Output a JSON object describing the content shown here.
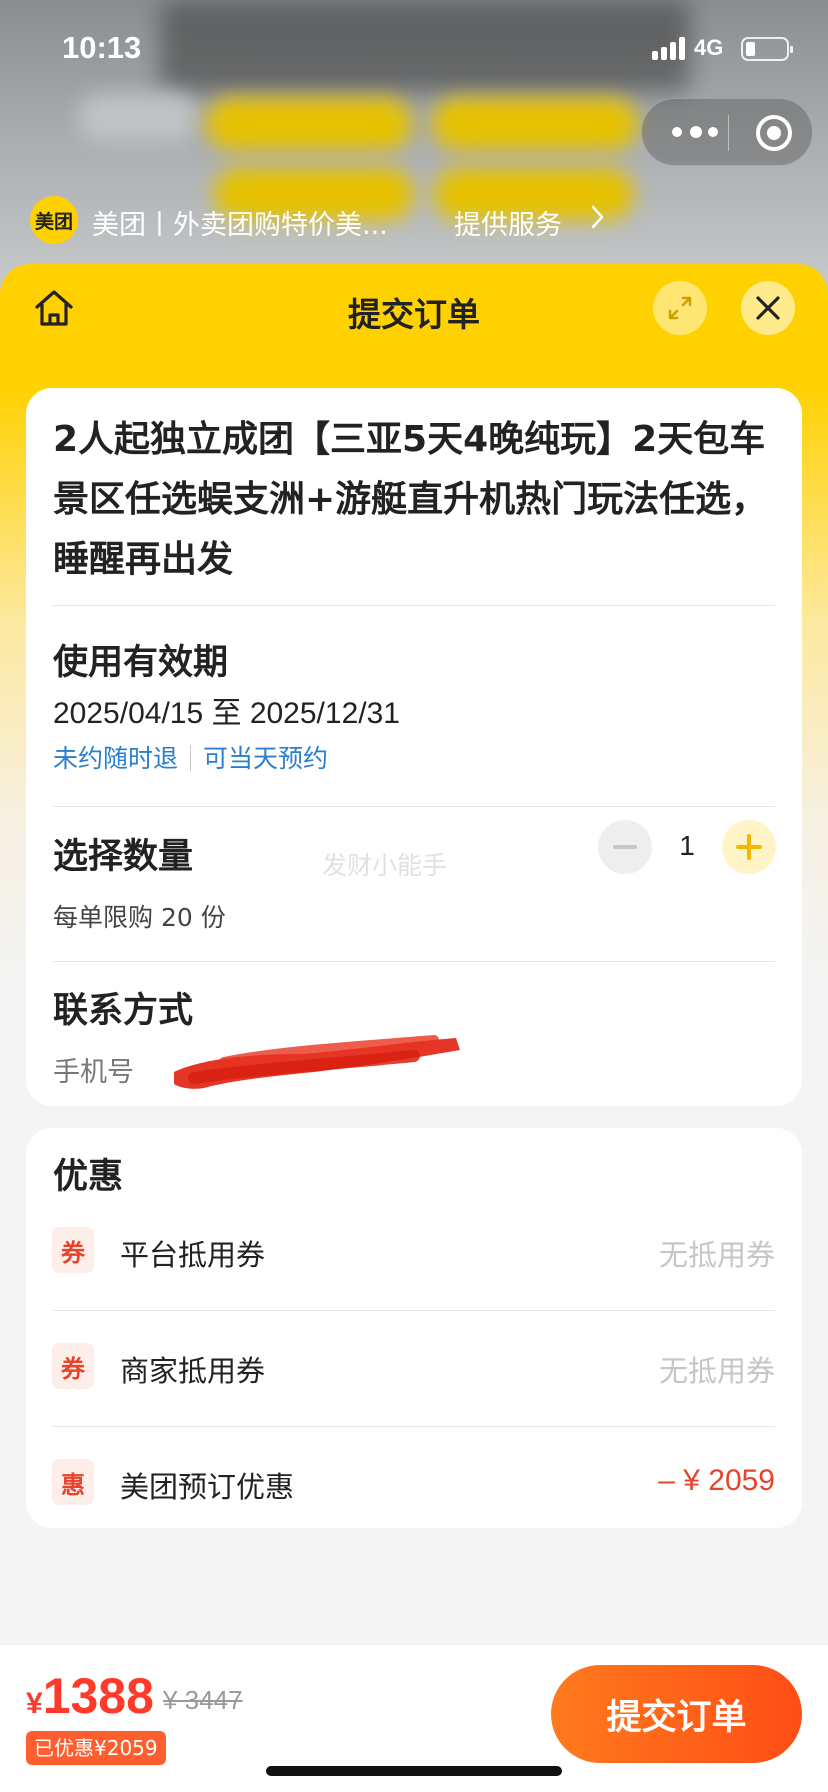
{
  "status_bar": {
    "time": "10:13",
    "network": "4G"
  },
  "mini_program": {
    "logo_text": "美团",
    "name": "美团丨外卖团购特价美...",
    "service_label": "提供服务",
    "service_icon": "chevron-right-icon"
  },
  "header": {
    "title": "提交订单",
    "home_icon": "home-icon",
    "expand_icon": "expand-icon",
    "close_icon": "close-icon"
  },
  "product": {
    "title": "2人起独立成团【三亚5天4晚纯玩】2天包车景区任选蜈支洲+游艇直升机热门玩法任选，睡醒再出发"
  },
  "validity": {
    "label": "使用有效期",
    "range": "2025/04/15 至 2025/12/31",
    "tags": [
      "未约随时退",
      "可当天预约"
    ]
  },
  "quantity": {
    "label": "选择数量",
    "value": "1",
    "limit_text": "每单限购 20 份"
  },
  "watermark": "发财小能手",
  "contact": {
    "label": "联系方式",
    "phone_label": "手机号"
  },
  "discounts": {
    "title": "优惠",
    "items": [
      {
        "badge": "券",
        "name": "平台抵用券",
        "value": "无抵用券"
      },
      {
        "badge": "券",
        "name": "商家抵用券",
        "value": "无抵用券"
      },
      {
        "badge": "惠",
        "name": "美团预订优惠",
        "value": "– ¥ 2059"
      }
    ]
  },
  "bottom": {
    "currency": "¥",
    "price": "1388",
    "original_price": "¥ 3447",
    "saved": "已优惠¥2059",
    "submit_label": "提交订单"
  },
  "colors": {
    "brand_yellow": "#ffd100",
    "price_red": "#ff3a2a",
    "submit_orange": "#ff5a1a",
    "link_blue": "#2a7fd0"
  }
}
